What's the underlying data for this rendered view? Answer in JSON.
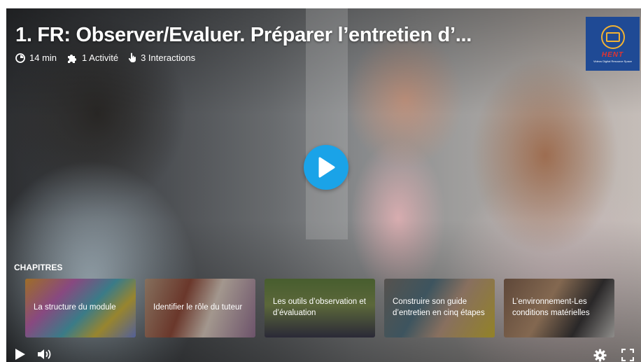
{
  "header": {
    "title": "1. FR: Observer/Evaluer. Préparer l’entretien d’...",
    "duration": "14 min",
    "activities": "1 Activité",
    "interactions": "3 Interactions"
  },
  "logo": {
    "text": "HENT",
    "subtitle": "Videos Digital Resource Space"
  },
  "chapters": {
    "label": "CHAPITRES",
    "items": [
      {
        "label": "La structure du module"
      },
      {
        "label": "Identifier le rôle du tuteur"
      },
      {
        "label": "Les outils d’observation et d’évaluation"
      },
      {
        "label": "Construire son guide d’entretien en cinq étapes"
      },
      {
        "label": "L’environnement-Les conditions matérielles"
      }
    ]
  },
  "icons": {
    "duration": "clock-icon",
    "activities": "puzzle-icon",
    "interactions": "hand-pointer-icon",
    "play_large": "play-icon",
    "play_small": "play-icon",
    "volume": "volume-icon",
    "settings": "gear-icon",
    "fullscreen": "fullscreen-icon"
  },
  "colors": {
    "accent": "#1aa3e8",
    "logo_bg": "#1f4a95",
    "logo_ring": "#f2b233",
    "logo_text": "#e3342f"
  }
}
